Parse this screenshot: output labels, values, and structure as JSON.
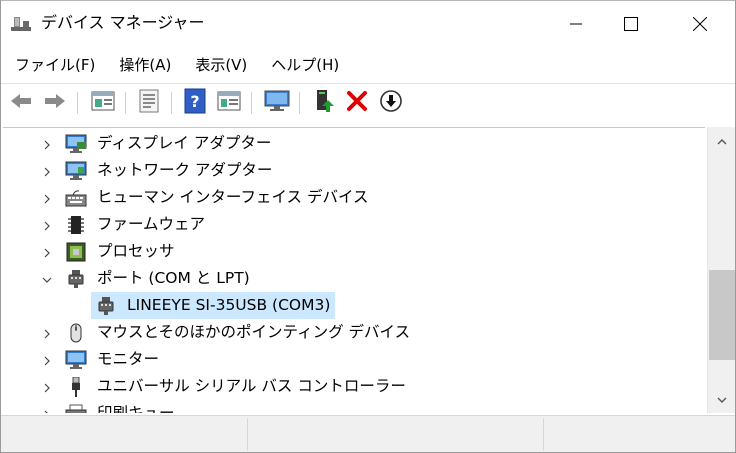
{
  "window": {
    "title": "デバイス マネージャー",
    "controls": [
      "minimize",
      "maximize",
      "close"
    ]
  },
  "menu": [
    "ファイル(F)",
    "操作(A)",
    "表示(V)",
    "ヘルプ(H)"
  ],
  "toolbar": {
    "buttons": [
      "back-icon",
      "forward-icon",
      "properties-icon",
      "update-view-icon",
      "help-icon",
      "action-view-icon",
      "scan-hardware-icon",
      "update-driver-icon",
      "uninstall-icon",
      "disable-icon"
    ]
  },
  "tree": {
    "rows": [
      {
        "label": "ディスプレイ アダプター",
        "expanded": false
      },
      {
        "label": "ネットワーク アダプター",
        "expanded": false
      },
      {
        "label": "ヒューマン インターフェイス デバイス",
        "expanded": false
      },
      {
        "label": "ファームウェア",
        "expanded": false
      },
      {
        "label": "プロセッサ",
        "expanded": false
      },
      {
        "label": "ポート (COM と LPT)",
        "expanded": true
      },
      {
        "label": "LINEEYE SI-35USB (COM3)",
        "child": true,
        "selected": true
      },
      {
        "label": "マウスとそのほかのポインティング デバイス",
        "expanded": false
      },
      {
        "label": "モニター",
        "expanded": false
      },
      {
        "label": "ユニバーサル シリアル バス コントローラー",
        "expanded": false
      },
      {
        "label": "印刷キュー",
        "expanded": false
      }
    ]
  },
  "colors": {
    "selection": "#cce8ff",
    "statusbar": "#f0f0f0",
    "uninstall_red": "#e00000"
  }
}
